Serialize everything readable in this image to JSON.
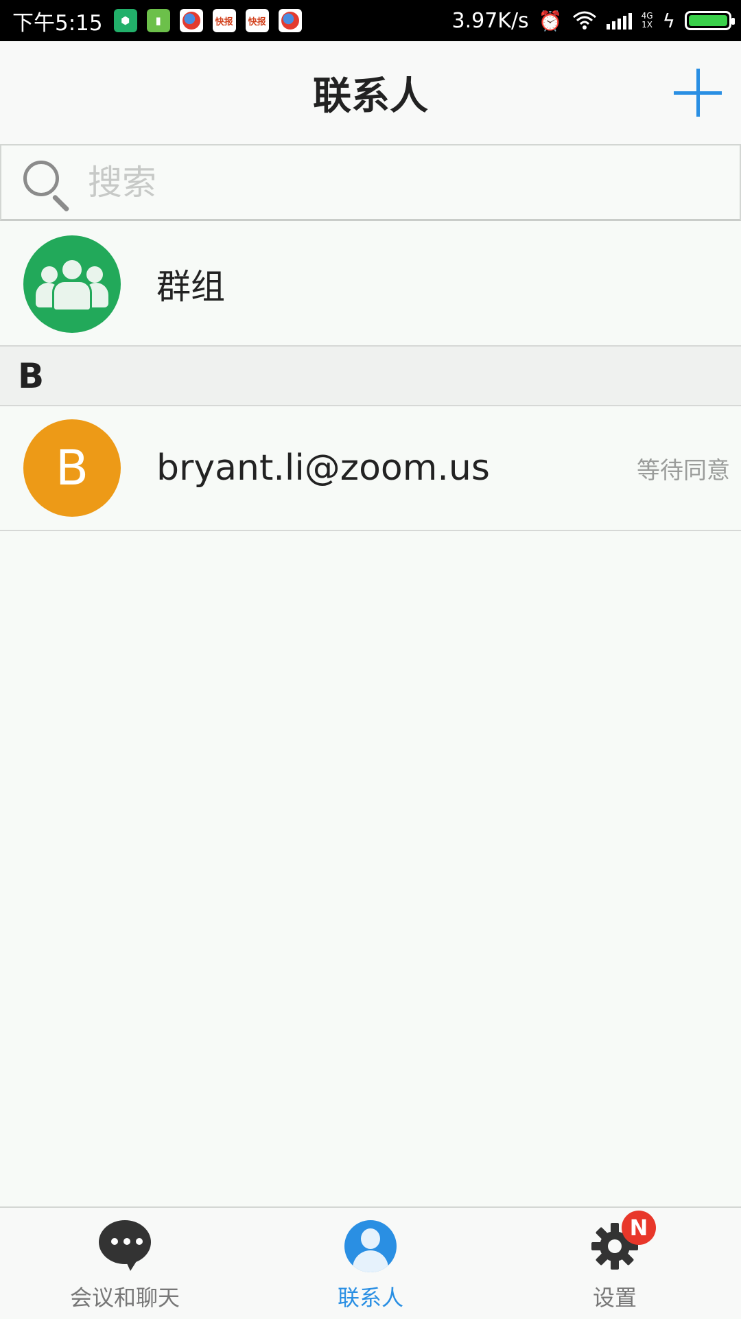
{
  "status_bar": {
    "time": "下午5:15",
    "news_app_label": "快报",
    "net_speed": "3.97K/s",
    "network_top": "4G",
    "network_bottom": "1X",
    "battery_level": 1.0
  },
  "header": {
    "title": "联系人",
    "add_icon": "plus-icon"
  },
  "search": {
    "placeholder": "搜索",
    "value": ""
  },
  "group_row": {
    "label": "群组",
    "icon": "group-icon"
  },
  "section": {
    "letter": "B"
  },
  "contacts": [
    {
      "initial": "B",
      "email": "bryant.li@zoom.us",
      "status": "等待同意",
      "avatar_color": "#ed9a17"
    }
  ],
  "bottom_nav": {
    "items": [
      {
        "label": "会议和聊天",
        "icon": "chat-bubble-icon",
        "active": false
      },
      {
        "label": "联系人",
        "icon": "contact-person-icon",
        "active": true
      },
      {
        "label": "设置",
        "icon": "gear-icon",
        "active": false,
        "badge": "N"
      }
    ]
  },
  "colors": {
    "accent": "#2a8fe3",
    "group_green": "#22a95a",
    "badge_red": "#e8372a"
  }
}
